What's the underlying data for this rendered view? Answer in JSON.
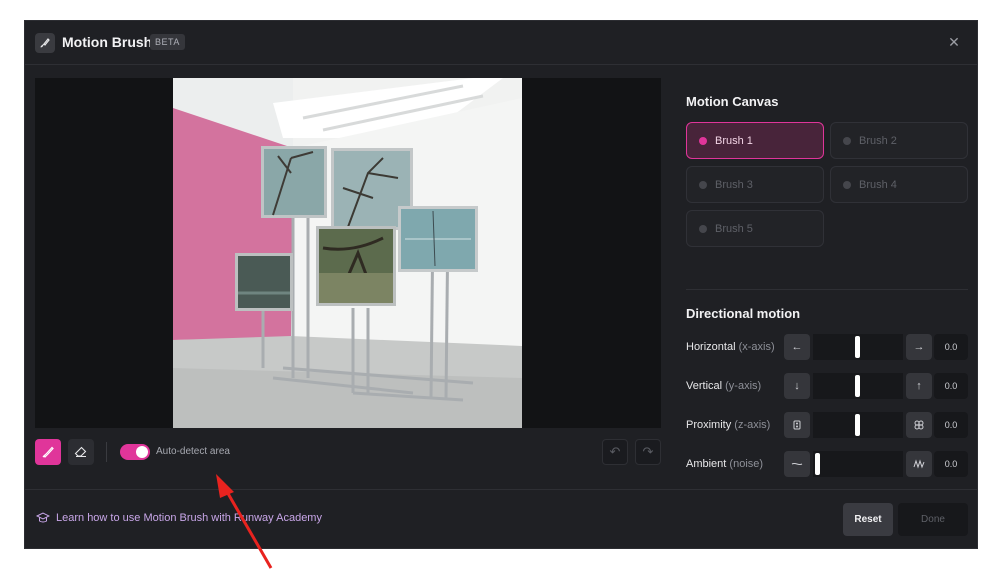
{
  "header": {
    "title": "Motion Brush",
    "badge": "BETA",
    "logo_icon": "brush-icon",
    "close_icon": "close-icon"
  },
  "canvas": {
    "image_description": "gallery installation of monitors on stands"
  },
  "toolbar": {
    "brush_tool_icon": "brush-icon",
    "eraser_tool_icon": "eraser-icon",
    "auto_detect_label": "Auto-detect area",
    "auto_detect_on": true,
    "undo_icon": "undo-icon",
    "redo_icon": "redo-icon"
  },
  "motion_canvas": {
    "title": "Motion Canvas",
    "brushes": [
      {
        "label": "Brush 1",
        "active": true
      },
      {
        "label": "Brush 2",
        "active": false
      },
      {
        "label": "Brush 3",
        "active": false
      },
      {
        "label": "Brush 4",
        "active": false
      },
      {
        "label": "Brush 5",
        "active": false
      }
    ]
  },
  "directional_motion": {
    "title": "Directional motion",
    "rows": [
      {
        "label": "Horizontal",
        "sub": "(x-axis)",
        "left_icon": "arrow-left-icon",
        "right_icon": "arrow-right-icon",
        "left_glyph": "←",
        "right_glyph": "→",
        "value": "0.0",
        "slider": 0.5
      },
      {
        "label": "Vertical",
        "sub": "(y-axis)",
        "left_icon": "arrow-down-icon",
        "right_icon": "arrow-up-icon",
        "left_glyph": "↓",
        "right_glyph": "↑",
        "value": "0.0",
        "slider": 0.5
      },
      {
        "label": "Proximity",
        "sub": "(z-axis)",
        "left_icon": "proximity-far-icon",
        "right_icon": "proximity-near-icon",
        "left_glyph": "",
        "right_glyph": "",
        "value": "0.0",
        "slider": 0.5
      },
      {
        "label": "Ambient",
        "sub": "(noise)",
        "left_icon": "flat-line-icon",
        "right_icon": "wave-icon",
        "left_glyph": "",
        "right_glyph": "",
        "value": "0.0",
        "slider": 0.0
      }
    ]
  },
  "footer": {
    "learn_link": "Learn how to use Motion Brush with Runway Academy",
    "learn_icon": "graduation-cap-icon",
    "reset_label": "Reset",
    "done_label": "Done"
  },
  "colors": {
    "accent": "#e0359a",
    "background": "#1f2024",
    "annotation_arrow": "#e8231f"
  }
}
